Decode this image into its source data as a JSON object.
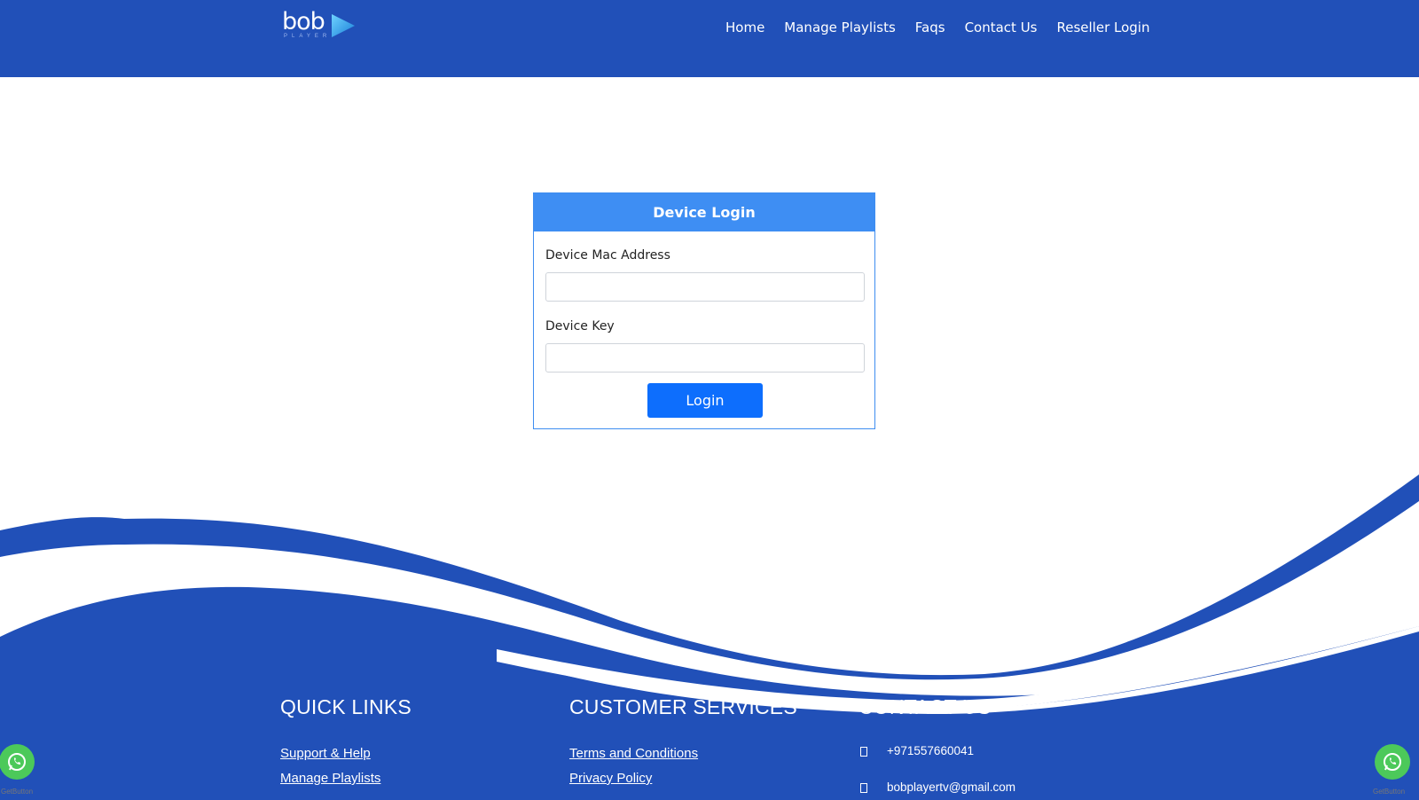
{
  "header": {
    "logo_text": "bob",
    "logo_sub": "PLAYER",
    "nav": [
      "Home",
      "Manage Playlists",
      "Faqs",
      "Contact Us",
      "Reseller Login"
    ]
  },
  "login": {
    "title": "Device Login",
    "mac_label": "Device Mac Address",
    "mac_value": "",
    "key_label": "Device Key",
    "key_value": "",
    "button": "Login"
  },
  "footer": {
    "quick_links": {
      "title": "QUICK LINKS",
      "items": [
        "Support & Help",
        "Manage Playlists"
      ]
    },
    "customer_services": {
      "title": "CUSTOMER SERVICES",
      "items": [
        "Terms and Conditions",
        "Privacy Policy"
      ]
    },
    "contact": {
      "title": "CONTACT US",
      "phone": "+971557660041",
      "email": "bobplayertv@gmail.com"
    }
  },
  "widgets": {
    "getbutton_label": "GetButton"
  },
  "colors": {
    "brand_blue": "#2150b8",
    "card_header": "#3e8ef3",
    "button": "#0d6efd",
    "whatsapp": "#4cc95a"
  }
}
